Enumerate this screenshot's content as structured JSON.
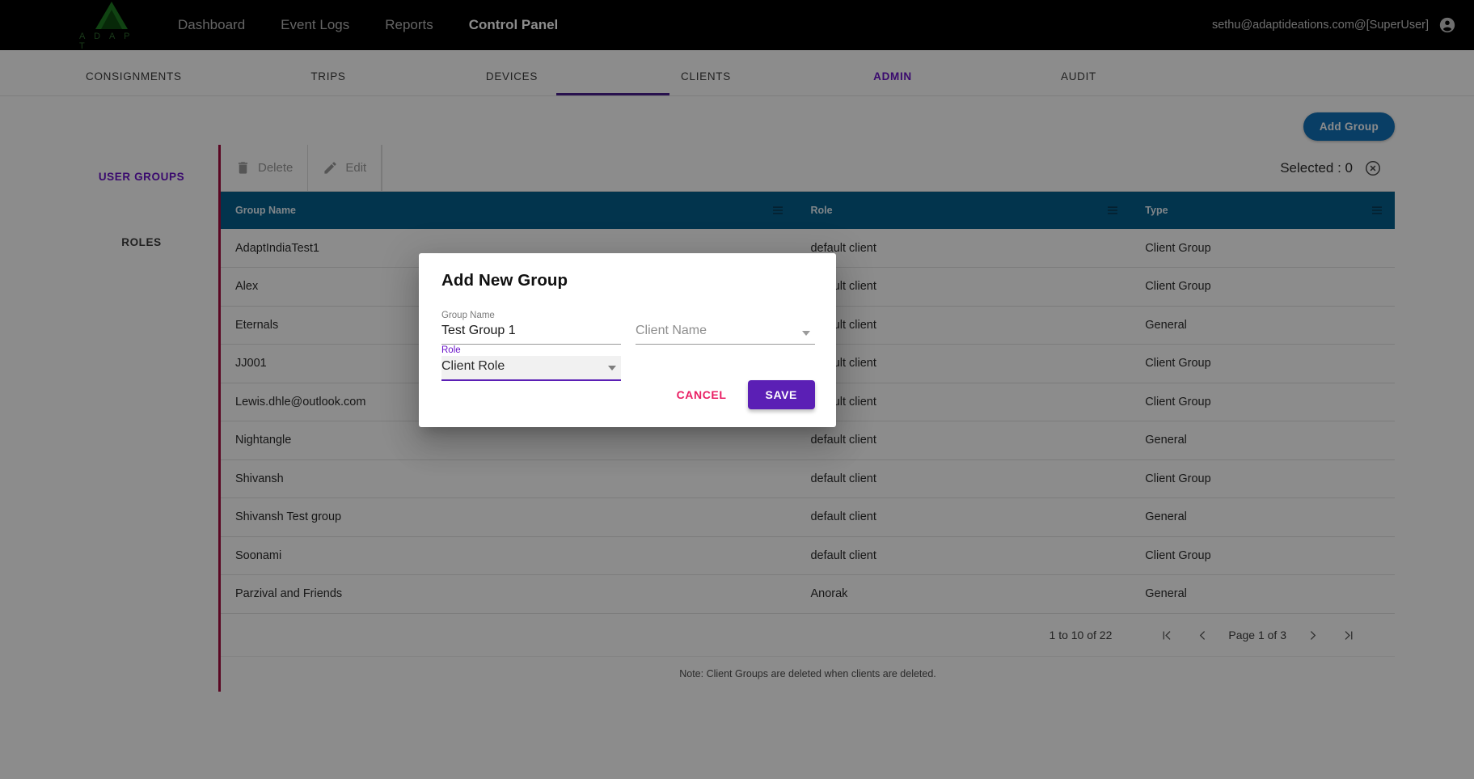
{
  "topnav": {
    "logo_text": "A D A P T",
    "links": [
      {
        "label": "Dashboard",
        "active": false
      },
      {
        "label": "Event Logs",
        "active": false
      },
      {
        "label": "Reports",
        "active": false
      },
      {
        "label": "Control Panel",
        "active": true
      }
    ],
    "user": "sethu@adaptideations.com@[SuperUser]",
    "avatar_icon": "account-circle-icon"
  },
  "tabs": [
    {
      "label": "CONSIGNMENTS",
      "active": false
    },
    {
      "label": "TRIPS",
      "active": false
    },
    {
      "label": "DEVICES",
      "active": false
    },
    {
      "label": "CLIENTS",
      "active": false
    },
    {
      "label": "ADMIN",
      "active": true
    },
    {
      "label": "AUDIT",
      "active": false
    }
  ],
  "add_group_button": "Add Group",
  "left_rail": [
    {
      "label": "USER GROUPS",
      "active": true
    },
    {
      "label": "ROLES",
      "active": false
    }
  ],
  "toolbar": {
    "delete_label": "Delete",
    "edit_label": "Edit",
    "selected_label": "Selected : 0",
    "clear_icon": "close-circle-icon",
    "delete_icon": "trash-icon",
    "edit_icon": "pencil-icon"
  },
  "table": {
    "columns": [
      "Group Name",
      "Role",
      "Type"
    ],
    "menu_icon": "hamburger-menu-icon",
    "rows": [
      {
        "group_name": "AdaptIndiaTest1",
        "role": "default client",
        "type": "Client Group"
      },
      {
        "group_name": "Alex",
        "role": "default client",
        "type": "Client Group"
      },
      {
        "group_name": "Eternals",
        "role": "default client",
        "type": "General"
      },
      {
        "group_name": "JJ001",
        "role": "default client",
        "type": "Client Group"
      },
      {
        "group_name": "Lewis.dhle@outlook.com",
        "role": "default client",
        "type": "Client Group"
      },
      {
        "group_name": "Nightangle",
        "role": "default client",
        "type": "General"
      },
      {
        "group_name": "Shivansh",
        "role": "default client",
        "type": "Client Group"
      },
      {
        "group_name": "Shivansh Test group",
        "role": "default client",
        "type": "General"
      },
      {
        "group_name": "Soonami",
        "role": "default client",
        "type": "Client Group"
      },
      {
        "group_name": "Parzival and Friends",
        "role": "Anorak",
        "type": "General"
      }
    ]
  },
  "pagination": {
    "range": "1 to 10 of 22",
    "first_icon": "first-page-icon",
    "prev_icon": "chevron-left-icon",
    "page_label": "Page 1 of 3",
    "next_icon": "chevron-right-icon",
    "last_icon": "last-page-icon"
  },
  "grid_note": "Note: Client Groups are deleted when clients are deleted.",
  "modal": {
    "title": "Add New Group",
    "group_name_label": "Group Name",
    "group_name_value": "Test Group 1",
    "client_name_placeholder": "Client Name",
    "role_label": "Role",
    "role_value": "Client Role",
    "cancel_label": "CANCEL",
    "save_label": "SAVE"
  },
  "colors": {
    "topnav_bg": "#000000",
    "accent_purple": "#5b1fb5",
    "tab_active": "#6a13c9",
    "table_header_bg": "#045f8c",
    "add_group_blue": "#1271b8",
    "panel_edge_red": "#a50b3f",
    "cancel_pink": "#e91e63"
  }
}
